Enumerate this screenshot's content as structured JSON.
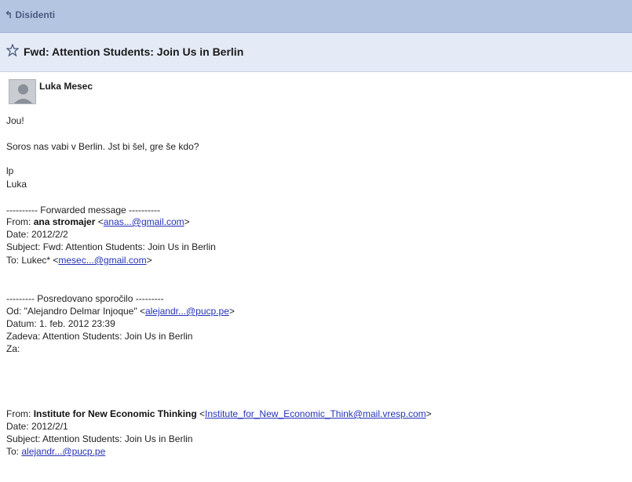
{
  "header": {
    "back_label": "Disidenti"
  },
  "subject": {
    "title": "Fwd: Attention Students: Join Us in Berlin"
  },
  "sender": {
    "name": "Luka Mesec"
  },
  "body": {
    "greeting": "Jou!",
    "text": "Soros nas vabi v Berlin. Jst bi šel, gre še kdo?",
    "closing1": "lp",
    "closing2": "Luka"
  },
  "forward1": {
    "separator": "---------- Forwarded message ----------",
    "from_prefix": "From:",
    "from_name": "ana stromajer",
    "from_email": "anas...@gmail.com",
    "date": "Date: 2012/2/2",
    "subject": "Subject: Fwd: Attention Students: Join Us in Berlin",
    "to_prefix": "To: Lukec*",
    "to_email": "mesec...@gmail.com"
  },
  "forward2": {
    "separator": "--------- Posredovano sporočilo ---------",
    "from_prefix": "Od: \"Alejandro Delmar Injoque\"",
    "from_email": "alejandr...@pucp.pe",
    "date": "Datum: 1. feb. 2012 23:39",
    "subject": "Zadeva: Attention Students: Join Us in Berlin",
    "to": "Za:"
  },
  "forward3": {
    "from_prefix": "From:",
    "from_name": "Institute for New Economic Thinking",
    "from_email": "Institute_for_New_Economic_Think@mail.vresp.com",
    "date": "Date: 2012/2/1",
    "subject": "Subject: Attention Students: Join Us in Berlin",
    "to_prefix": "To:",
    "to_email": "alejandr...@pucp.pe"
  }
}
